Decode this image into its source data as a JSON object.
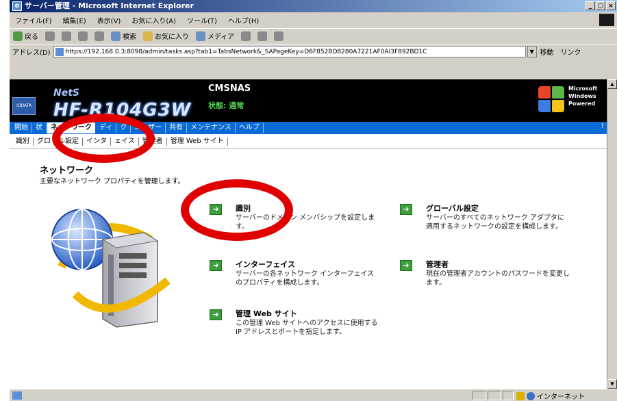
{
  "window": {
    "title": "サーバー管理 - Microsoft Internet Explorer",
    "controls": [
      "_",
      "□",
      "×"
    ]
  },
  "menu": [
    "ファイル(F)",
    "編集(E)",
    "表示(V)",
    "お気に入り(A)",
    "ツール(T)",
    "ヘルプ(H)"
  ],
  "toolbar": {
    "back": "戻る",
    "search": "検索",
    "favorites": "お気に入り",
    "media": "メディア"
  },
  "address": {
    "label": "アドレス(D)",
    "url": "https://192.168.0.3:8098/admin/tasks.asp?tab1=TabsNetwork&_SAPageKey=D6F852BD8280A7221AF0AI3F892BD1C",
    "go": "移動",
    "links": "リンク"
  },
  "banner": {
    "badge": "IODATA",
    "brand": "NetS",
    "model": "HF-R104G3W",
    "server_name": "CMSNAS",
    "status": "状態: 通常",
    "windows_text": [
      "Microsoft",
      "Windows",
      "Powered"
    ]
  },
  "nav": {
    "tabs": [
      "開始",
      "状",
      "ネットワーク",
      "ディ",
      "ク",
      "ユーザー",
      "共有",
      "メンテナンス",
      "ヘルプ"
    ],
    "active": "ネットワーク"
  },
  "subnav": [
    "識別",
    "グロ",
    "ル設定",
    "インタ",
    "ェイス",
    "管理者",
    "管理 Web サイト"
  ],
  "page": {
    "title": "ネットワーク",
    "description": "主要なネットワーク プロパティを管理します。"
  },
  "tasks": [
    {
      "name": "識別",
      "desc": "サーバーのドメイン メンバシップを設定します。"
    },
    {
      "name": "グローバル設定",
      "desc": "サーバーのすべてのネットワーク アダプタに適用するネットワークの設定を構成します。"
    },
    {
      "name": "インターフェイス",
      "desc": "サーバーの各ネットワーク インターフェイスのプロパティを構成します。"
    },
    {
      "name": "管理者",
      "desc": "現在の管理者アカウントのパスワードを変更します。"
    },
    {
      "name": "管理 Web サイト",
      "desc": "この管理 Web サイトへのアクセスに使用する IP アドレスとポートを指定します。"
    }
  ],
  "statusbar": {
    "zone": "インターネット"
  },
  "colors": {
    "nav_blue": "#0a6bd6",
    "annotation_red": "#e00000",
    "task_icon_green": "#3e9e3e"
  }
}
